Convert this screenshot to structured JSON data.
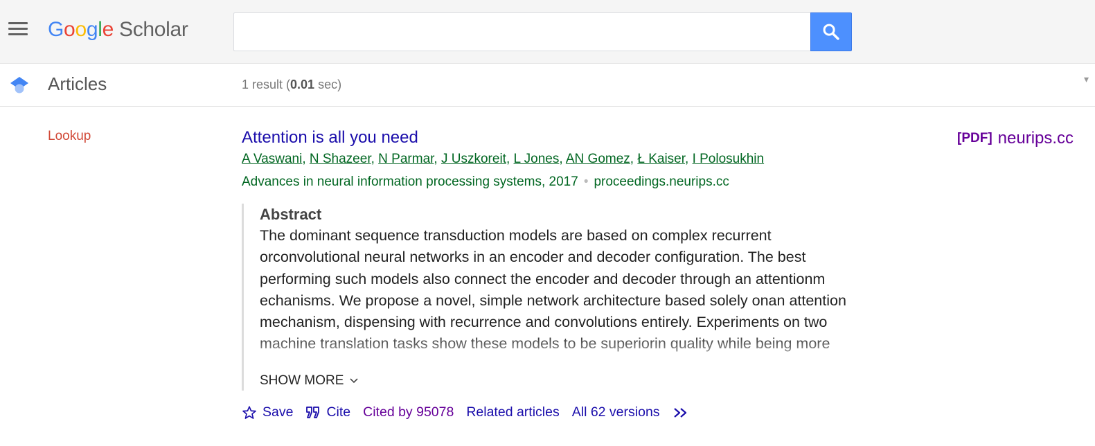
{
  "header": {
    "logo_letters": [
      "G",
      "o",
      "o",
      "g",
      "l",
      "e"
    ],
    "logo_suffix": "Scholar",
    "search_value": "",
    "colors": {
      "accent": "#4d90fe",
      "header_bg": "#f5f5f5"
    }
  },
  "subbar": {
    "section_title": "Articles",
    "result_count_prefix": "1 result (",
    "result_time": "0.01",
    "result_count_suffix": " sec)"
  },
  "sidebar": {
    "lookup_label": "Lookup"
  },
  "result": {
    "title": "Attention is all you need",
    "pdf_tag": "[PDF]",
    "pdf_domain": "neurips.cc",
    "authors": [
      "A Vaswani",
      "N Shazeer",
      "N Parmar",
      "J Uszkoreit",
      "L Jones",
      "AN Gomez",
      "Ł Kaiser",
      "I Polosukhin"
    ],
    "venue": "Advances in neural information processing systems, 2017",
    "source_domain": "proceedings.neurips.cc",
    "abstract_heading": "Abstract",
    "abstract_lines": [
      "The dominant sequence transduction models are based on complex recurrent",
      "orconvolutional neural networks in an encoder and decoder configuration. The best",
      "performing such models also connect the encoder and decoder through an attentionm",
      "echanisms. We propose a novel, simple network architecture based solely onan attention",
      "mechanism, dispensing with recurrence and convolutions entirely. Experiments on two",
      "machine translation tasks show these models to be superiorin quality while being more"
    ],
    "show_more_label": "SHOW MORE",
    "actions": {
      "save": "Save",
      "cite": "Cite",
      "cited_by": "Cited by 95078",
      "related": "Related articles",
      "versions": "All 62 versions"
    }
  }
}
